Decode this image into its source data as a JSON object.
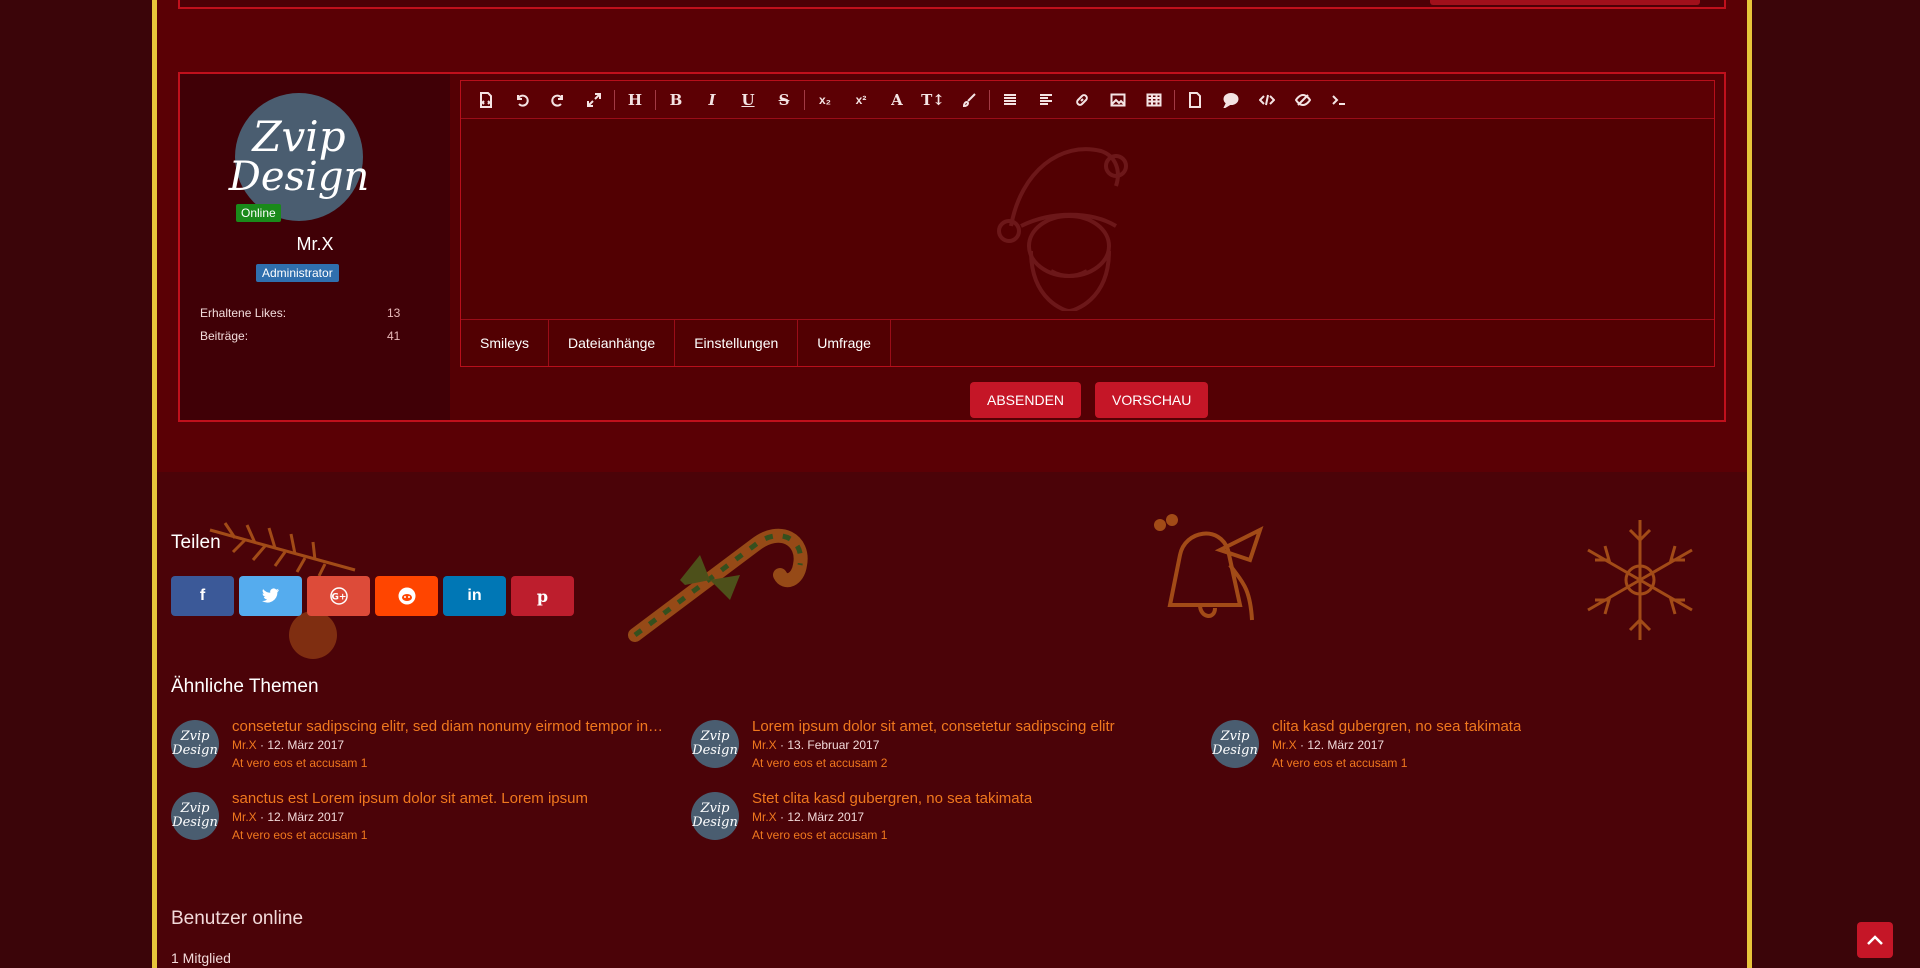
{
  "avatar": {
    "line1": "Zvip",
    "line2": "Design"
  },
  "user": {
    "online_label": "Online",
    "name": "Mr.X",
    "role": "Administrator",
    "stats": [
      {
        "label": "Erhaltene Likes:",
        "value": "13"
      },
      {
        "label": "Beiträge:",
        "value": "41"
      }
    ]
  },
  "editor": {
    "toolbar_icons": [
      "source-icon",
      "undo-icon",
      "redo-icon",
      "fullscreen-icon",
      "heading-icon",
      "bold-icon",
      "italic-icon",
      "underline-icon",
      "strikethrough-icon",
      "subscript-icon",
      "superscript-icon",
      "font-color-icon",
      "font-size-icon",
      "paint-brush-icon",
      "list-icon",
      "align-icon",
      "link-icon",
      "image-icon",
      "table-icon",
      "page-icon",
      "quote-icon",
      "code-icon",
      "spoiler-icon",
      "terminal-icon"
    ],
    "tabs": [
      "Smileys",
      "Dateianhänge",
      "Einstellungen",
      "Umfrage"
    ]
  },
  "buttons": {
    "submit": "ABSENDEN",
    "preview": "VORSCHAU"
  },
  "share": {
    "title": "Teilen",
    "networks": [
      "facebook-icon",
      "twitter-icon",
      "google-plus-icon",
      "reddit-icon",
      "linkedin-icon",
      "pinterest-icon"
    ]
  },
  "similar": {
    "title": "Ähnliche Themen",
    "threads": [
      {
        "title": "consetetur sadipscing elitr, sed diam nonumy eirmod tempor invi...",
        "author": "Mr.X",
        "date": "12. März 2017",
        "sub": "At vero eos et accusam 1"
      },
      {
        "title": "Lorem ipsum dolor sit amet, consetetur sadipscing elitr",
        "author": "Mr.X",
        "date": "13. Februar 2017",
        "sub": "At vero eos et accusam 2"
      },
      {
        "title": "clita kasd gubergren, no sea takimata",
        "author": "Mr.X",
        "date": "12. März 2017",
        "sub": "At vero eos et accusam 1"
      },
      {
        "title": "sanctus est Lorem ipsum dolor sit amet. Lorem ipsum",
        "author": "Mr.X",
        "date": "12. März 2017",
        "sub": "At vero eos et accusam 1"
      },
      {
        "title": "Stet clita kasd gubergren, no sea takimata",
        "author": "Mr.X",
        "date": "12. März 2017",
        "sub": "At vero eos et accusam 1"
      }
    ]
  },
  "online": {
    "title": "Benutzer online",
    "count": "1 Mitglied"
  },
  "colors": {
    "accent": "#c51627",
    "link": "#f0781e",
    "frame": "#e8c53a",
    "border": "#c0101c"
  }
}
